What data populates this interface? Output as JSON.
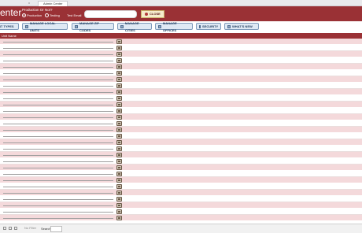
{
  "browser": {
    "tab_title": "Admin Center",
    "tab_mark": "x"
  },
  "header": {
    "brand_fragment": "enter",
    "production_question": "Production Or Not?",
    "radio_production": "Production",
    "radio_testing": "Testing",
    "test_email_label": "Test Email",
    "test_email_value": "",
    "close_button_label": "CLOSE"
  },
  "nav": {
    "buttons": [
      {
        "label": "NT TYPES"
      },
      {
        "label": "MANAGE LOCAL UNITS"
      },
      {
        "label": "MANAGE ZIP CODES"
      },
      {
        "label": "MANAGE CITIES"
      },
      {
        "label": "MANAGE OFFICES"
      },
      {
        "label": "SECURITY"
      },
      {
        "label": "WHAT'S NEW"
      }
    ]
  },
  "list": {
    "header_label": "Unit Name"
  },
  "footer": {
    "pager_status": "No Filter",
    "search_label": "Search",
    "search_value": ""
  },
  "colors": {
    "brand": "#9a3135",
    "row_alt": "#f4d9db",
    "nav_button_bg": "#dfe9f4"
  }
}
